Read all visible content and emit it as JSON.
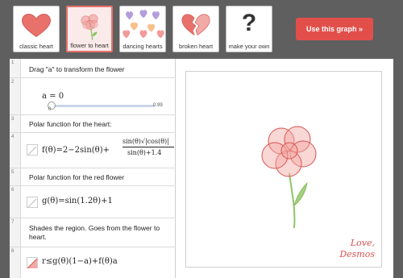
{
  "thumbnails": [
    {
      "label": "classic heart",
      "active": false
    },
    {
      "label": "flower to heart",
      "active": true
    },
    {
      "label": "dancing hearts",
      "active": false
    },
    {
      "label": "broken heart",
      "active": false
    },
    {
      "label": "make your own",
      "active": false,
      "icon": "question-mark-icon",
      "icon_text": "?"
    }
  ],
  "use_button": "Use this graph »",
  "expressions": [
    {
      "number": "1",
      "text": "Drag \"a\" to transform the flower"
    },
    {
      "number": "2",
      "math": "a = 0",
      "slider_min": "0",
      "slider_max": "0.99"
    },
    {
      "number": "3",
      "text": "Polar function for the heart:"
    },
    {
      "number": "4",
      "math": "f(θ)=2−2sin(θ)+",
      "fraction_num": "sin(θ)√|cos(θ)|",
      "fraction_den": "sin(θ)+1.4"
    },
    {
      "number": "5",
      "text": "Polar function for the red flower"
    },
    {
      "number": "6",
      "math": "g(θ)=sin(1.2θ)+1"
    },
    {
      "number": "7",
      "text": "Shades the region. Goes from the flower to heart."
    },
    {
      "number": "8",
      "math": "r≤g(θ)(1−a)+f(θ)a"
    }
  ],
  "signature": [
    "Love,",
    "Desmos"
  ],
  "colors": {
    "accent": "#e24f4b",
    "petal": "#e8716c",
    "stem": "#8fc46a"
  }
}
